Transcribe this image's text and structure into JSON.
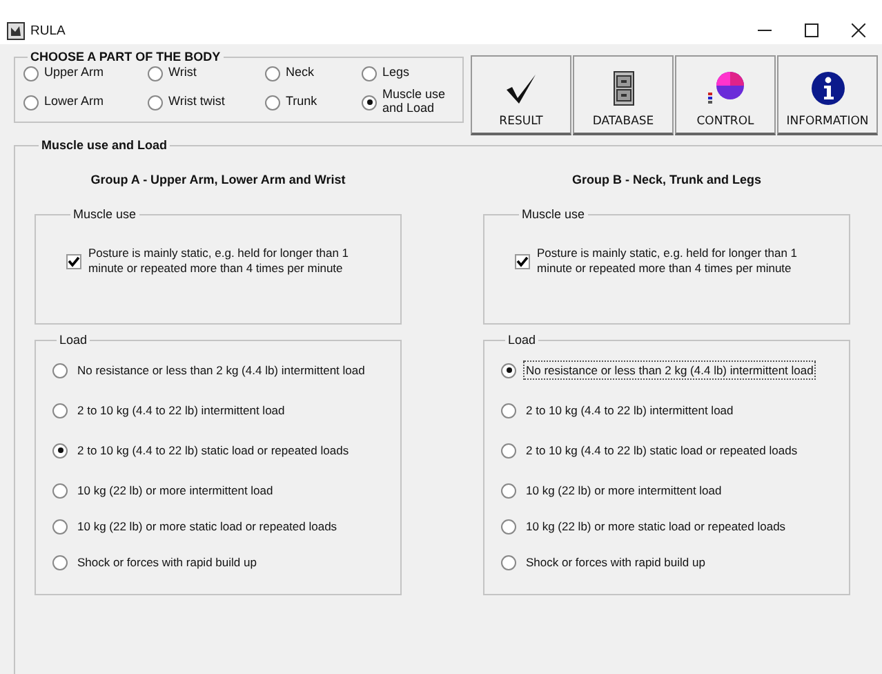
{
  "window": {
    "title": "RULA"
  },
  "body_parts": {
    "title": "CHOOSE A PART OF THE BODY",
    "options": [
      {
        "label": "Upper Arm",
        "selected": false
      },
      {
        "label": "Wrist",
        "selected": false
      },
      {
        "label": "Neck",
        "selected": false
      },
      {
        "label": "Legs",
        "selected": false
      },
      {
        "label": "Lower Arm",
        "selected": false
      },
      {
        "label": "Wrist twist",
        "selected": false
      },
      {
        "label": "Trunk",
        "selected": false
      },
      {
        "label": "Muscle use and Load",
        "selected": true
      }
    ]
  },
  "toolbar": [
    {
      "label": "RESULT",
      "kind": "check"
    },
    {
      "label": "DATABASE",
      "kind": "cabinet"
    },
    {
      "label": "CONTROL",
      "kind": "chart"
    },
    {
      "label": "INFORMATION",
      "kind": "info"
    }
  ],
  "section": {
    "title": "Muscle use and Load",
    "groups": [
      {
        "title": "Group A - Upper Arm, Lower Arm and Wrist",
        "muscle_use": {
          "title": "Muscle use",
          "label": "Posture is mainly static, e.g. held for longer than 1 minute or repeated more than 4 times per minute",
          "checked": true
        },
        "load": {
          "title": "Load",
          "options": [
            {
              "label": "No resistance or less than 2 kg (4.4 lb) intermittent load",
              "selected": false,
              "focused": false
            },
            {
              "label": "2 to 10 kg (4.4 to 22 lb) intermittent load",
              "selected": false,
              "focused": false
            },
            {
              "label": "2 to 10 kg (4.4 to 22 lb) static load or repeated loads",
              "selected": true,
              "focused": false
            },
            {
              "label": "10 kg (22 lb) or more intermittent load",
              "selected": false,
              "focused": false
            },
            {
              "label": "10 kg (22 lb) or more static load or repeated loads",
              "selected": false,
              "focused": false
            },
            {
              "label": "Shock or forces with rapid build up",
              "selected": false,
              "focused": false
            }
          ]
        }
      },
      {
        "title": "Group B - Neck, Trunk and Legs",
        "muscle_use": {
          "title": "Muscle use",
          "label": "Posture is mainly static, e.g. held for longer than 1 minute or repeated more than 4 times per minute",
          "checked": true
        },
        "load": {
          "title": "Load",
          "options": [
            {
              "label": "No resistance or less than 2 kg (4.4 lb) intermittent load",
              "selected": true,
              "focused": true
            },
            {
              "label": "2 to 10 kg (4.4 to 22 lb) intermittent load",
              "selected": false,
              "focused": false
            },
            {
              "label": "2 to 10 kg (4.4 to 22 lb) static load or repeated loads",
              "selected": false,
              "focused": false
            },
            {
              "label": "10 kg (22 lb) or more intermittent load",
              "selected": false,
              "focused": false
            },
            {
              "label": "10 kg (22 lb) or more static load or repeated loads",
              "selected": false,
              "focused": false
            },
            {
              "label": "Shock or forces with rapid build up",
              "selected": false,
              "focused": false
            }
          ]
        }
      }
    ]
  }
}
